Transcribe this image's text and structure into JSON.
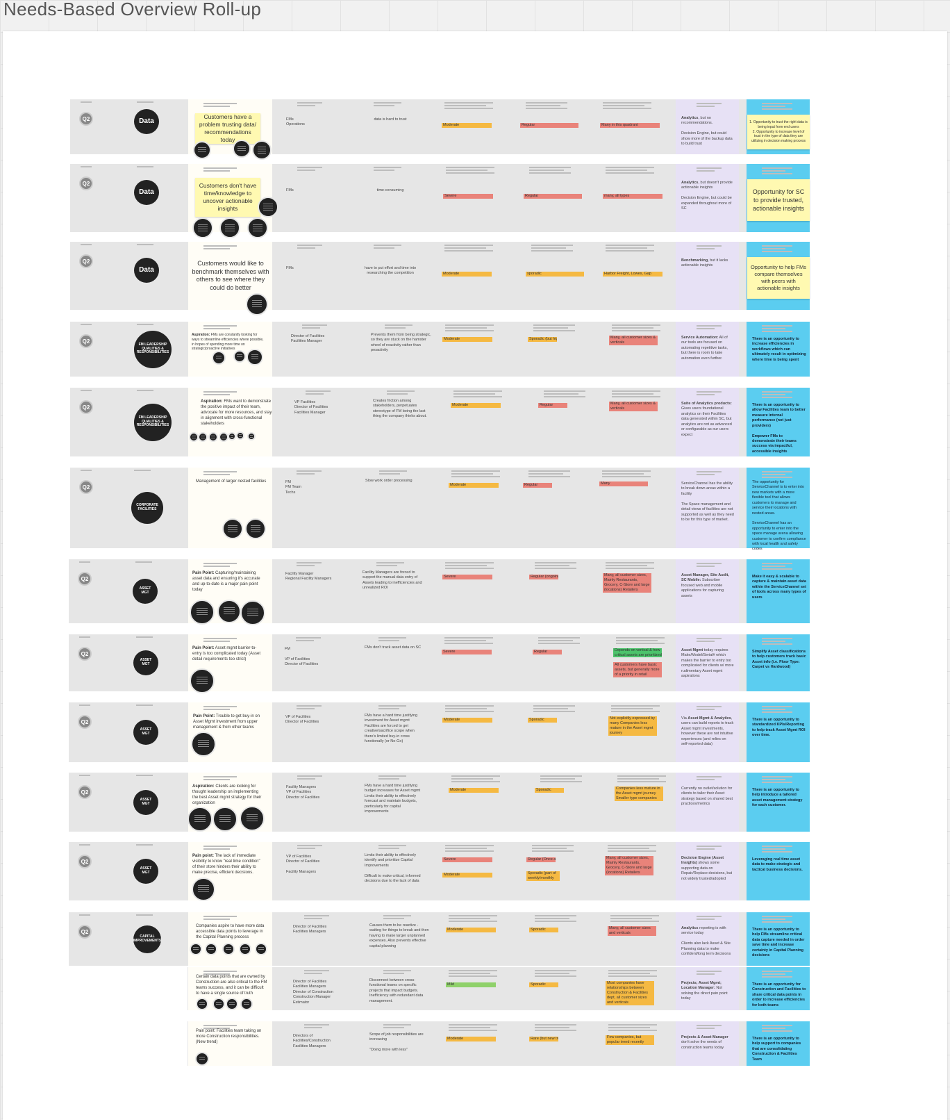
{
  "board": {
    "title": "Needs-Based Overview Roll-up"
  },
  "colors": {
    "moderate": "#f5b942",
    "severe": "#e9837a",
    "regular": "#e9837a",
    "sporadic": "#f5b942",
    "mild": "#8fd16a",
    "solution": "#e7e1f5",
    "opportunity": "#5bcdf0",
    "sticky": "#fff9b1",
    "accent_green": "#4cc36b"
  },
  "rows": [
    {
      "quarter": "Q2",
      "category": "Data",
      "need": "Customers have a problem trusting data/ recommendations today",
      "roles": "FMs\nOperations",
      "impact": "data is hard to trust",
      "severity": "Moderate",
      "frequency": "Regular",
      "reach": "Many in this quadrant",
      "solution_bold": "Analytics",
      "solution": ", but no recommendations.\n\nDecision Engine, but could show more of the backup data to build trust",
      "opportunity": "1. Opportunity to trust the right data is being input from end users\n2. Opportunity to increase level of trust in the type of data they are utilizing in decision making process"
    },
    {
      "quarter": "Q2",
      "category": "Data",
      "need": "Customers don't have time/knowledge to uncover actionable insights",
      "roles": "FMs",
      "impact": "time-consuming",
      "severity": "Severe",
      "frequency": "Regular",
      "reach": "many, all types",
      "solution_bold": "Analytics",
      "solution": ", but doesn't provide actionable insights\n\nDecision Engine, but could be expanded throughout more of SC",
      "opportunity": "Opportunity for SC to provide trusted, actionable insights"
    },
    {
      "quarter": "Q2",
      "category": "Data",
      "need": "Customers would like to benchmark themselves with others to see where they could do better",
      "roles": "FMs",
      "impact": "have to put effort and time into researching the competition",
      "severity": "Moderate",
      "frequency": "sporadic",
      "reach": "Harbor Freight, Lowes, Gap",
      "solution_bold": "Benchmarking",
      "solution": ", but it lacks actionable insights",
      "opportunity": "Opportunity to help FMs compare themselves with peers with actionable insights"
    },
    {
      "quarter": "Q2",
      "category": "FM LEADERSHIP QUALITIES & RESPONSIBILITIES",
      "need_bold": "Aspiration:",
      "need": " FMs are constantly looking for ways to streamline efficiencies where possible, in hopes of spending more time on strategic/proactive initiatives",
      "roles": "Director of Facilities\nFacilities Manager",
      "impact": "Prevents them from being strategic, so they are stuck on the hamster wheel of reactivity rather than proactivity",
      "severity": "Moderate",
      "frequency": "Sporadic (but high frequency)",
      "reach": "Many, all customer sizes & verticals",
      "solution_bold": "Service Automation:",
      "solution": " All of our tools are focused on automating repetitive tasks, but there is room to take automation even further.",
      "opportunity": "There is an opportunity to increase efficiencies in workflows which can ultimately result in optimizing where time is being spent"
    },
    {
      "quarter": "Q2",
      "category": "FM LEADERSHIP QUALITIES & RESPONSIBILITIES",
      "need_bold": "Aspiration:",
      "need": " FMs want to demonstrate the positive impact of their team, advocate for more resources, and stay in alignment with cross-functional stakeholders",
      "roles": "VP Facilities\nDirector of Facilities\nFacilities Manager",
      "impact": "Creates friction among stakeholders, perpetuates stereotype of FM being the last thing the company thinks about.",
      "severity": "Moderate",
      "frequency": "Regular",
      "reach": "Many, all customer sizes & verticals",
      "solution_bold": "Suite of Analytics products:",
      "solution": " Gives users foundational analytics on their Facilities data generated within SC, but analytics are not as advanced or configurable as our users expect",
      "opportunity": "There is an opportunity to allow Facilities team to better measure internal performance (not just providers)\n\nEmpower FMs to demonstrate their teams success via impactful, accessible insights"
    },
    {
      "quarter": "Q2",
      "category": "CORPORATE FACILITIES",
      "need": "Management of larger nested facilities",
      "roles": "FM\nFM Team\nTechs",
      "impact": "Slow work order processing",
      "severity": "Moderate",
      "frequency": "Regular",
      "reach": "Many",
      "solution": "ServiceChannel has the ability to break down areas within a facility\n\nThe Space management and detail views of facilities are not supported as well as they need to be for this type of market.",
      "opportunity": "The opportunity for ServiceChannel is to enter into new markets with a more flexible tool that allows customers to manage and service their locations with nested areas.\n\nServiceChannel has an opportunity to enter into the space manage arena allowing customer to confirm compliance with local health and safety codes"
    },
    {
      "quarter": "Q2",
      "category": "ASSET MGT",
      "need_bold": "Pain Point:",
      "need": " Capturing/maintaining asset data and ensuring it's accurate and up-to-date is a major pain point today",
      "roles": "Facility Manager\nRegional Facility Managers",
      "impact": "Facility Managers are forced to support the manual data entry of Assets leading to inefficiencies and unrealized ROI",
      "severity": "Severe",
      "frequency": "Regular (ongoing)",
      "reach": "Many, all customer sizes, Mainly Restaurants, Grocery, C-Store and large (locations) Retailers",
      "solution_bold": "Asset Manager, Site Audit, SC Mobile:",
      "solution": " Subscriber focused web and mobile applications for capturing assets",
      "opportunity": "Make it easy & scalable to capture & maintain asset data within the ServiceChannel set of tools across many types of users"
    },
    {
      "quarter": "Q2",
      "category": "ASSET MGT",
      "need_bold": "Pain Point:",
      "need": " Asset mgmt barrier-to-entry is too complicated today (Asset detail requirements too strict)",
      "roles": "FM\n\nVP of Facilities\nDirector of Facilities",
      "impact": "FMs don't track asset data on SC",
      "severity": "Severe",
      "frequency": "Regular",
      "reach": "Depends on vertical & how critical assets are prioritized\n\nAll customers have basic assets, but generally more of a priority in retail",
      "solution_bold": "Asset Mgmt",
      "solution": " today requires Make/Model/Serial# which makes the barrier to entry too complicated for clients w/ more rudimentary Asset mgmt aspirations",
      "opportunity": "Simplify Asset classifications to help customers track basic Asset info (i.e. Floor Type: Carpet vs Hardwood)"
    },
    {
      "quarter": "Q2",
      "category": "ASSET MGT",
      "need_bold": "Pain Point:",
      "need": " Trouble to get buy-in on Asset Mgmt investment from upper management & from other teams",
      "roles": "VP of Facilities\nDirector of Facilities",
      "impact": "FMs have a hard time justifying investment for Asset mgmt\nFacilities are forced to get creative/sacrifice scope when there's limited buy-in cross functionally (or No-Go)",
      "severity": "Moderate",
      "frequency": "Sporadic",
      "reach": "Not explicitly expressed by many\nCompanies less mature in the Asset mgmt journey",
      "solution_bold": "Asset Mgmt & Analytics",
      "solution_pre": "Via ",
      "solution": ", users can build reports to track Asset mgmt investments, however these are not intuitive experiences (and relies on self-reported data)",
      "opportunity": "There is an opportunity to standardized KPIs/Reporting to help track Asset Mgmt ROI over time."
    },
    {
      "quarter": "Q2",
      "category": "ASSET MGT",
      "need_bold": "Aspiration:",
      "need": " Clients are looking for thought leadership on implementing the best Asset mgmt strategy for their organization",
      "roles": "Facility Managers\nVP of Facilities\nDirector of Facilities",
      "impact": "FMs have a hard time justifying budget increases for Asset mgmt\nLimits their ability to effectively forecast and maintain budgets, particularly for capital improvements",
      "severity": "Moderate",
      "frequency": "Sporadic",
      "reach": "Companies less mature in the Asset mgmt journey\nSmaller type companies",
      "solution": "Currently no outlet/solution for clients to tailor their Asset strategy based on shared best practices/metrics",
      "opportunity": "There is an opportunity to help introduce a tailored asset management strategy for each customer."
    },
    {
      "quarter": "Q2",
      "category": "ASSET MGT",
      "need_bold": "Pain point:",
      "need": " The lack of immediate visibility to know \"real time condition\" of their store hinders their ability to make precise, efficient decisions.",
      "roles": "VP of Facilities\nDirector of Facilities\n\nFacility Managers",
      "impact": "Limits their ability to effectively identify and prioritize Capital Improvements\n\nDifficult to make critical, informed decisions due to the lack of data",
      "severity": "Severe",
      "severity2": "Moderate",
      "frequency": "Regular (Once a year)",
      "frequency2": "Sporadic (part of weekly/monthly CBE)",
      "reach": "Many, all customer sizes, Mainly Restaurants, Grocery, C-Store and large (locations) Retailers",
      "solution_bold": "Decision Engine (Asset Insights)",
      "solution": " shows some supporting data on Repair/Replace decisions, but not widely trusted/adopted",
      "opportunity": "Leveraging real time asset data to make strategic and tactical business decisions."
    },
    {
      "quarter": "Q2",
      "category": "CAPITAL IMPROVEMENTS",
      "need": "Companies aspire to have more data accessible data points to leverage in the Capital Planning process",
      "roles": "Director of Facilities\nFacilities Managers",
      "impact": "Causes them to be reactive - waiting for things to break and then having to make larger unplanned expenses. Also prevents effective capital planning",
      "severity": "Moderate",
      "frequency": "Sporadic",
      "reach": "Many, all customer sizes and verticals",
      "solution_bold": "Analytics",
      "solution": " reporting is with service today\n\nClients also lack Asset & Site Planning data to make confident/long term decisions",
      "opportunity": "There is an opportunity to help FMs streamline critical data capture needed in order save time and increase certainty in Capital Planning decisions"
    },
    {
      "quarter": "",
      "category": "",
      "need": "Certain data points that are owned by Construction are also critical to the FM teams success, and it can be difficult to have a single source of truth",
      "roles": "Director of Facilities\nFacilities Managers\nDirector of Construction\nConstruction Manager\nEstimator",
      "impact": "Disconnect between cross-functional teams on specific projects that impact budgets. Inefficiency with redundant data management.",
      "severity": "Mild",
      "frequency": "Sporadic",
      "reach": "Most companies have relationships between Construction & Facilities dept, all customer sizes and verticals",
      "solution_bold": "Projects; Asset Mgmt; Location Manager:",
      "solution": " Not solving the direct pain point today",
      "opportunity": "There is an opportunity for Construction and Facilities to share critical data points in order to increase efficiencies for both teams"
    },
    {
      "quarter": "",
      "category": "",
      "need": "Pain point: Facilities team taking on more Construction responsibilities. (New trend)",
      "roles": "Directors of Facilities/Construction\nFacilities Managers",
      "impact": "Scope of job responsibilities are increasing\n\n\"Doing more with less\"",
      "severity": "Moderate",
      "frequency": "Rare (but new trend?)",
      "reach": "Few companies, but popular trend recently",
      "solution_bold": "Projects & Asset Manager",
      "solution": " don't solve the needs of construction teams today",
      "opportunity": "There is an opportunity to help support to companies that are consolidating Construction & Facilities Team"
    }
  ]
}
